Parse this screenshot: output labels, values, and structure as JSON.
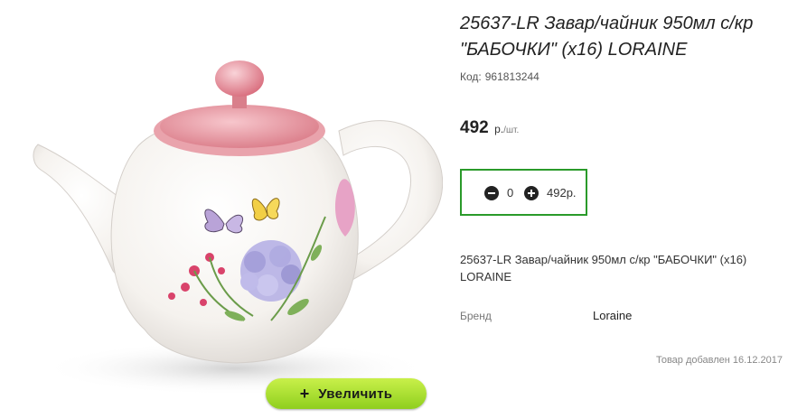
{
  "product": {
    "title": "25637-LR Завар/чайник 950мл с/кр \"БАБОЧКИ\" (x16) LORAINE",
    "code_label": "Код:",
    "code_value": "961813244",
    "price_value": "492",
    "price_unit": "р.",
    "price_per": "/шт.",
    "quantity": "0",
    "quantity_sum": "492р.",
    "description": "25637-LR Завар/чайник 950мл с/кр \"БАБОЧКИ\" (x16) LORAINE",
    "brand_label": "Бренд",
    "brand_value": "Loraine",
    "added_date": "Товар добавлен 16.12.2017"
  },
  "image": {
    "zoom_plus": "+",
    "zoom_label": "Увеличить"
  },
  "colors": {
    "teapot_body": "#f7f4ef",
    "teapot_lid": "#e8919b",
    "accent_green": "#2a9a2a",
    "zoom_button": "#a9e234"
  }
}
